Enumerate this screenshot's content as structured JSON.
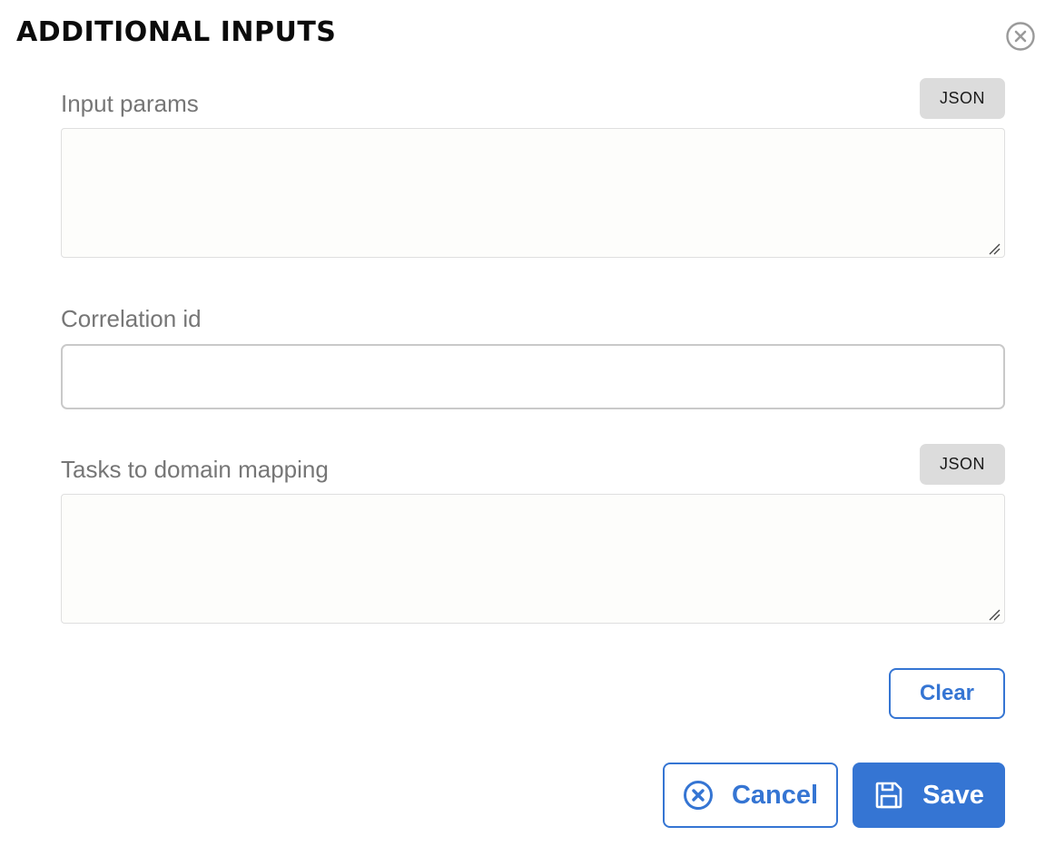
{
  "dialog": {
    "title": "ADDITIONAL INPUTS",
    "close_icon": "close-circle-icon"
  },
  "fields": {
    "input_params": {
      "label": "Input params",
      "json_button": "JSON",
      "value": ""
    },
    "correlation_id": {
      "label": "Correlation id",
      "value": ""
    },
    "task_to_domain": {
      "label": "Tasks to domain mapping",
      "json_button": "JSON",
      "value": ""
    }
  },
  "actions": {
    "clear_label": "Clear",
    "cancel_label": "Cancel",
    "cancel_icon": "close-circle-icon",
    "save_label": "Save",
    "save_icon": "floppy-disk-icon"
  },
  "colors": {
    "accent": "#3575d3",
    "json_button_bg": "#dcdcdc",
    "label_text": "#767676"
  }
}
